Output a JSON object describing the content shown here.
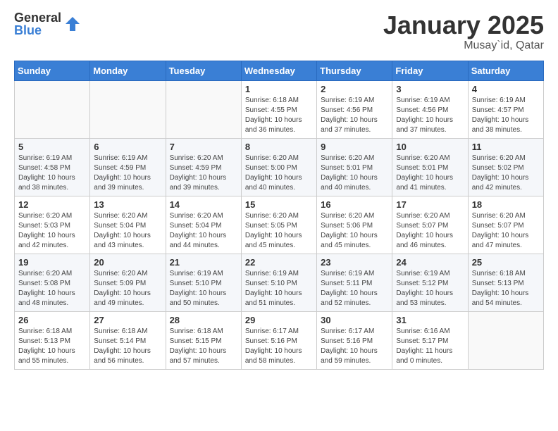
{
  "logo": {
    "general": "General",
    "blue": "Blue"
  },
  "header": {
    "month": "January 2025",
    "location": "Musay`id, Qatar"
  },
  "weekdays": [
    "Sunday",
    "Monday",
    "Tuesday",
    "Wednesday",
    "Thursday",
    "Friday",
    "Saturday"
  ],
  "weeks": [
    [
      {
        "day": "",
        "info": ""
      },
      {
        "day": "",
        "info": ""
      },
      {
        "day": "",
        "info": ""
      },
      {
        "day": "1",
        "info": "Sunrise: 6:18 AM\nSunset: 4:55 PM\nDaylight: 10 hours\nand 36 minutes."
      },
      {
        "day": "2",
        "info": "Sunrise: 6:19 AM\nSunset: 4:56 PM\nDaylight: 10 hours\nand 37 minutes."
      },
      {
        "day": "3",
        "info": "Sunrise: 6:19 AM\nSunset: 4:56 PM\nDaylight: 10 hours\nand 37 minutes."
      },
      {
        "day": "4",
        "info": "Sunrise: 6:19 AM\nSunset: 4:57 PM\nDaylight: 10 hours\nand 38 minutes."
      }
    ],
    [
      {
        "day": "5",
        "info": "Sunrise: 6:19 AM\nSunset: 4:58 PM\nDaylight: 10 hours\nand 38 minutes."
      },
      {
        "day": "6",
        "info": "Sunrise: 6:19 AM\nSunset: 4:59 PM\nDaylight: 10 hours\nand 39 minutes."
      },
      {
        "day": "7",
        "info": "Sunrise: 6:20 AM\nSunset: 4:59 PM\nDaylight: 10 hours\nand 39 minutes."
      },
      {
        "day": "8",
        "info": "Sunrise: 6:20 AM\nSunset: 5:00 PM\nDaylight: 10 hours\nand 40 minutes."
      },
      {
        "day": "9",
        "info": "Sunrise: 6:20 AM\nSunset: 5:01 PM\nDaylight: 10 hours\nand 40 minutes."
      },
      {
        "day": "10",
        "info": "Sunrise: 6:20 AM\nSunset: 5:01 PM\nDaylight: 10 hours\nand 41 minutes."
      },
      {
        "day": "11",
        "info": "Sunrise: 6:20 AM\nSunset: 5:02 PM\nDaylight: 10 hours\nand 42 minutes."
      }
    ],
    [
      {
        "day": "12",
        "info": "Sunrise: 6:20 AM\nSunset: 5:03 PM\nDaylight: 10 hours\nand 42 minutes."
      },
      {
        "day": "13",
        "info": "Sunrise: 6:20 AM\nSunset: 5:04 PM\nDaylight: 10 hours\nand 43 minutes."
      },
      {
        "day": "14",
        "info": "Sunrise: 6:20 AM\nSunset: 5:04 PM\nDaylight: 10 hours\nand 44 minutes."
      },
      {
        "day": "15",
        "info": "Sunrise: 6:20 AM\nSunset: 5:05 PM\nDaylight: 10 hours\nand 45 minutes."
      },
      {
        "day": "16",
        "info": "Sunrise: 6:20 AM\nSunset: 5:06 PM\nDaylight: 10 hours\nand 45 minutes."
      },
      {
        "day": "17",
        "info": "Sunrise: 6:20 AM\nSunset: 5:07 PM\nDaylight: 10 hours\nand 46 minutes."
      },
      {
        "day": "18",
        "info": "Sunrise: 6:20 AM\nSunset: 5:07 PM\nDaylight: 10 hours\nand 47 minutes."
      }
    ],
    [
      {
        "day": "19",
        "info": "Sunrise: 6:20 AM\nSunset: 5:08 PM\nDaylight: 10 hours\nand 48 minutes."
      },
      {
        "day": "20",
        "info": "Sunrise: 6:20 AM\nSunset: 5:09 PM\nDaylight: 10 hours\nand 49 minutes."
      },
      {
        "day": "21",
        "info": "Sunrise: 6:19 AM\nSunset: 5:10 PM\nDaylight: 10 hours\nand 50 minutes."
      },
      {
        "day": "22",
        "info": "Sunrise: 6:19 AM\nSunset: 5:10 PM\nDaylight: 10 hours\nand 51 minutes."
      },
      {
        "day": "23",
        "info": "Sunrise: 6:19 AM\nSunset: 5:11 PM\nDaylight: 10 hours\nand 52 minutes."
      },
      {
        "day": "24",
        "info": "Sunrise: 6:19 AM\nSunset: 5:12 PM\nDaylight: 10 hours\nand 53 minutes."
      },
      {
        "day": "25",
        "info": "Sunrise: 6:18 AM\nSunset: 5:13 PM\nDaylight: 10 hours\nand 54 minutes."
      }
    ],
    [
      {
        "day": "26",
        "info": "Sunrise: 6:18 AM\nSunset: 5:13 PM\nDaylight: 10 hours\nand 55 minutes."
      },
      {
        "day": "27",
        "info": "Sunrise: 6:18 AM\nSunset: 5:14 PM\nDaylight: 10 hours\nand 56 minutes."
      },
      {
        "day": "28",
        "info": "Sunrise: 6:18 AM\nSunset: 5:15 PM\nDaylight: 10 hours\nand 57 minutes."
      },
      {
        "day": "29",
        "info": "Sunrise: 6:17 AM\nSunset: 5:16 PM\nDaylight: 10 hours\nand 58 minutes."
      },
      {
        "day": "30",
        "info": "Sunrise: 6:17 AM\nSunset: 5:16 PM\nDaylight: 10 hours\nand 59 minutes."
      },
      {
        "day": "31",
        "info": "Sunrise: 6:16 AM\nSunset: 5:17 PM\nDaylight: 11 hours\nand 0 minutes."
      },
      {
        "day": "",
        "info": ""
      }
    ]
  ]
}
